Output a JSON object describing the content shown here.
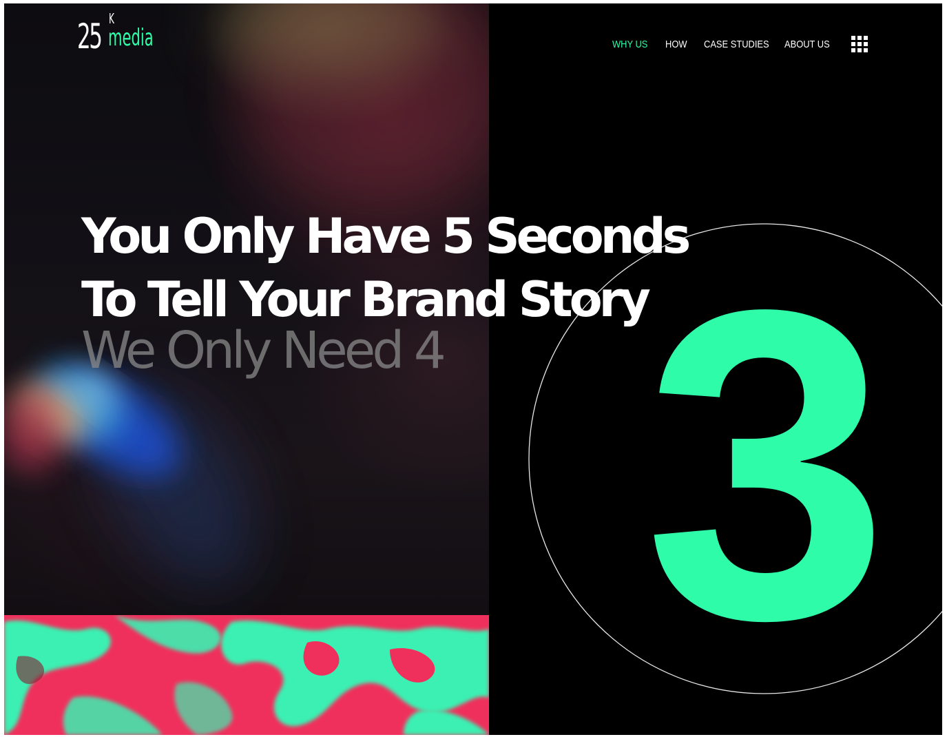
{
  "brand": {
    "logo_number": "25",
    "logo_superscript": "K",
    "logo_word": "media",
    "accent_color": "#2ffca8"
  },
  "nav": {
    "items": [
      {
        "label": "WHY US",
        "active": true
      },
      {
        "label": "HOW",
        "active": false
      },
      {
        "label": "CASE STUDIES",
        "active": false
      },
      {
        "label": "ABOUT US",
        "active": false
      }
    ],
    "menu_icon": "grid-menu-icon"
  },
  "hero": {
    "headline_line1": "You Only Have 5 Seconds",
    "headline_line2": "To Tell Your Brand Story",
    "subline": "We Only Need 4",
    "countdown": "3"
  },
  "colors": {
    "background": "#000000",
    "accent_green": "#2ffca8",
    "accent_pink": "#f0305c",
    "subline_gray": "#8a8a8a"
  }
}
